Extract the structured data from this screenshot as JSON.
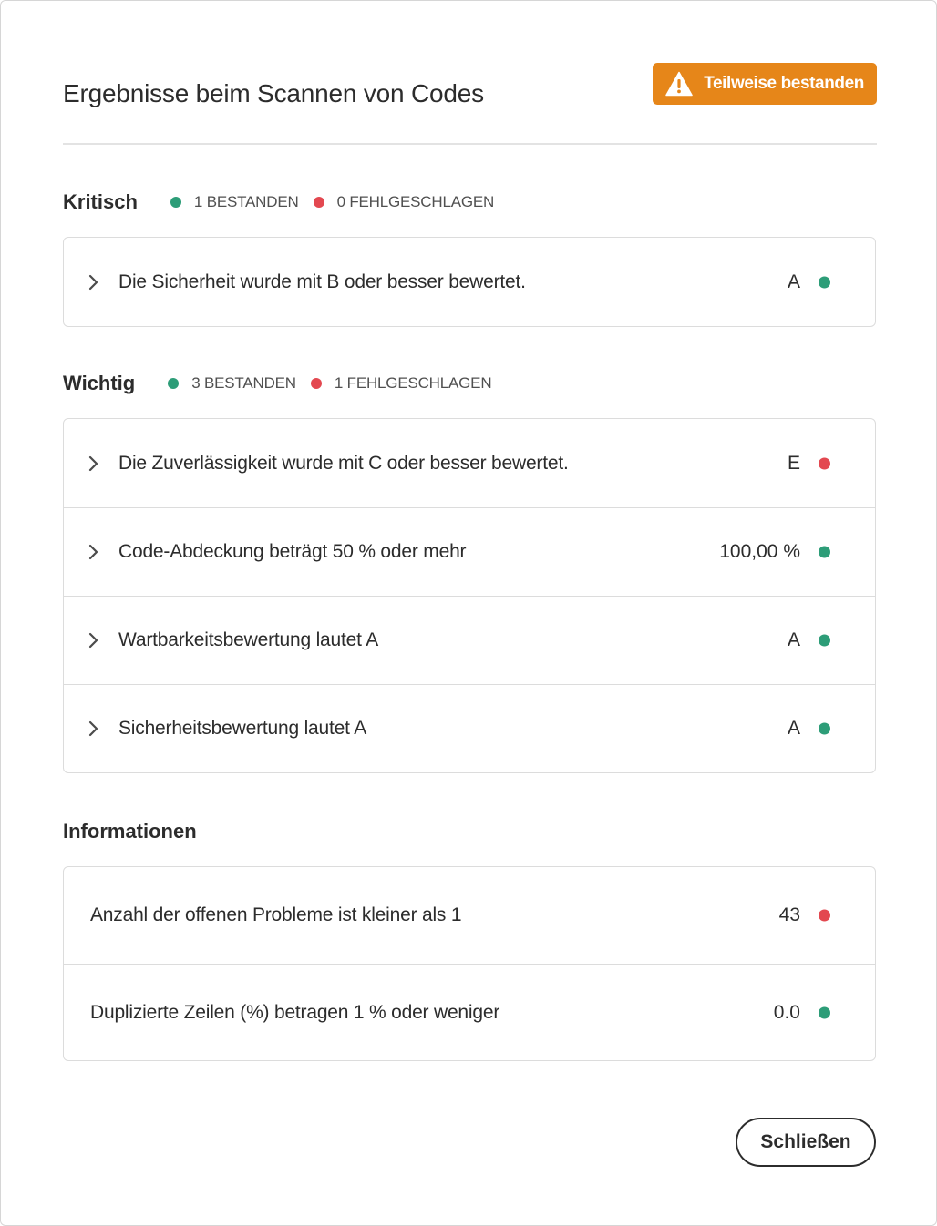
{
  "dialog": {
    "title": "Ergebnisse beim Scannen von Codes",
    "status_badge": {
      "label": "Teilweise bestanden",
      "icon": "warning-icon",
      "color": "#e68619"
    },
    "close_label": "Schließen"
  },
  "colors": {
    "pass": "#2d9d78",
    "fail": "#e34850",
    "warning": "#e68619"
  },
  "sections": {
    "critical": {
      "title": "Kritisch",
      "passed": "1 BESTANDEN",
      "failed": "0 FEHLGESCHLAGEN",
      "rows": [
        {
          "label": "Die Sicherheit wurde mit B oder besser bewertet.",
          "value": "A",
          "status": "pass"
        }
      ]
    },
    "important": {
      "title": "Wichtig",
      "passed": "3 BESTANDEN",
      "failed": "1 FEHLGESCHLAGEN",
      "rows": [
        {
          "label": "Die Zuverlässigkeit wurde mit C oder besser bewertet.",
          "value": "E",
          "status": "fail"
        },
        {
          "label": "Code-Abdeckung beträgt 50 % oder mehr",
          "value": "100,00 %",
          "status": "pass"
        },
        {
          "label": "Wartbarkeitsbewertung lautet A",
          "value": "A",
          "status": "pass"
        },
        {
          "label": "Sicherheitsbewertung lautet A",
          "value": "A",
          "status": "pass"
        }
      ]
    },
    "info": {
      "title": "Informationen",
      "rows": [
        {
          "label": "Anzahl der offenen Probleme ist kleiner als 1",
          "value": "43",
          "status": "fail"
        },
        {
          "label": "Duplizierte Zeilen (%) betragen 1 % oder weniger",
          "value": "0.0",
          "status": "pass"
        }
      ]
    }
  }
}
